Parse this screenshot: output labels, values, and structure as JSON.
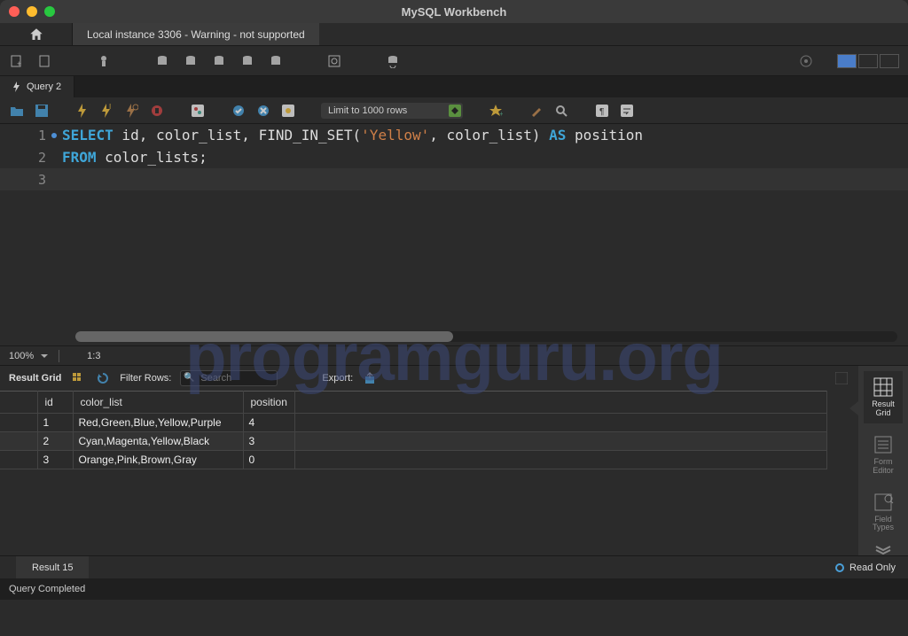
{
  "window": {
    "title": "MySQL Workbench"
  },
  "connection_tab": "Local instance 3306 - Warning - not supported",
  "query_tab": "Query 2",
  "limit": "Limit to 1000 rows",
  "sql": {
    "lines": [
      {
        "n": "1",
        "tokens": [
          {
            "t": "SELECT",
            "c": "kw"
          },
          {
            "t": " id",
            "c": "ident"
          },
          {
            "t": ", ",
            "c": "punc"
          },
          {
            "t": "color_list",
            "c": "ident"
          },
          {
            "t": ", ",
            "c": "punc"
          },
          {
            "t": "FIND_IN_SET",
            "c": "fn"
          },
          {
            "t": "(",
            "c": "punc"
          },
          {
            "t": "'Yellow'",
            "c": "str"
          },
          {
            "t": ", ",
            "c": "punc"
          },
          {
            "t": "color_list",
            "c": "ident"
          },
          {
            "t": ") ",
            "c": "punc"
          },
          {
            "t": "AS",
            "c": "kw"
          },
          {
            "t": " position",
            "c": "ident"
          }
        ]
      },
      {
        "n": "2",
        "tokens": [
          {
            "t": "FROM",
            "c": "kw"
          },
          {
            "t": " color_lists",
            "c": "ident"
          },
          {
            "t": ";",
            "c": "punc"
          }
        ]
      },
      {
        "n": "3",
        "tokens": []
      }
    ]
  },
  "zoom": "100%",
  "cursor": "1:3",
  "result": {
    "label": "Result Grid",
    "filter_label": "Filter Rows:",
    "search_placeholder": "Search",
    "export_label": "Export:",
    "columns": [
      "",
      "id",
      "color_list",
      "position"
    ],
    "rows": [
      {
        "rownum": "",
        "id": "1",
        "color_list": "Red,Green,Blue,Yellow,Purple",
        "position": "4"
      },
      {
        "rownum": "",
        "id": "2",
        "color_list": "Cyan,Magenta,Yellow,Black",
        "position": "3"
      },
      {
        "rownum": "",
        "id": "3",
        "color_list": "Orange,Pink,Brown,Gray",
        "position": "0"
      }
    ],
    "tab": "Result 15",
    "readonly": "Read Only"
  },
  "sidebar": {
    "items": [
      {
        "label": "Result\nGrid"
      },
      {
        "label": "Form\nEditor"
      },
      {
        "label": "Field\nTypes"
      }
    ]
  },
  "status": "Query Completed",
  "watermark": "programguru.org"
}
